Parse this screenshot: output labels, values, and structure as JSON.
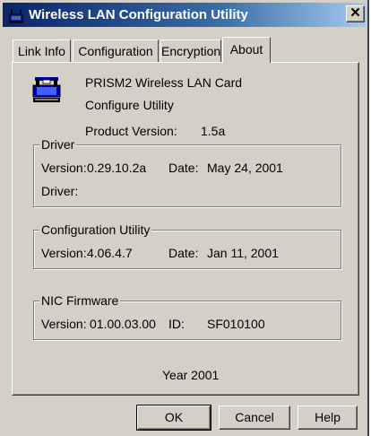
{
  "window": {
    "title": "Wireless LAN Configuration Utility",
    "close_glyph": "✕"
  },
  "tabs": [
    {
      "label": "Link Info"
    },
    {
      "label": "Configuration"
    },
    {
      "label": "Encryption"
    },
    {
      "label": "About",
      "active": true
    }
  ],
  "about": {
    "card_name": "PRISM2 Wireless LAN Card",
    "utility_name": "Configure Utility",
    "product_version_label": "Product Version:",
    "product_version": "1.5a"
  },
  "driver": {
    "title": "Driver",
    "version_label": "Version:",
    "version": "0.29.10.2a",
    "date_label": "Date:",
    "date": "May 24, 2001",
    "driver_label": "Driver:"
  },
  "config_utility": {
    "title": "Configuration Utility",
    "version_label": "Version:",
    "version": "4.06.4.7",
    "date_label": "Date:",
    "date": "Jan 11, 2001"
  },
  "nic_firmware": {
    "title": "NIC Firmware",
    "version_label": "Version:",
    "version": "01.00.03.00",
    "id_label": "ID:",
    "id": "SF010100"
  },
  "year_text": "Year 2001",
  "buttons": {
    "ok": "OK",
    "cancel": "Cancel",
    "help": "Help"
  },
  "colors": {
    "face": "#d4d0c8",
    "title_start": "#0a246a",
    "title_end": "#a6caf0"
  },
  "icons": {
    "title": "wireless-network-icon",
    "about": "wireless-card-icon"
  }
}
